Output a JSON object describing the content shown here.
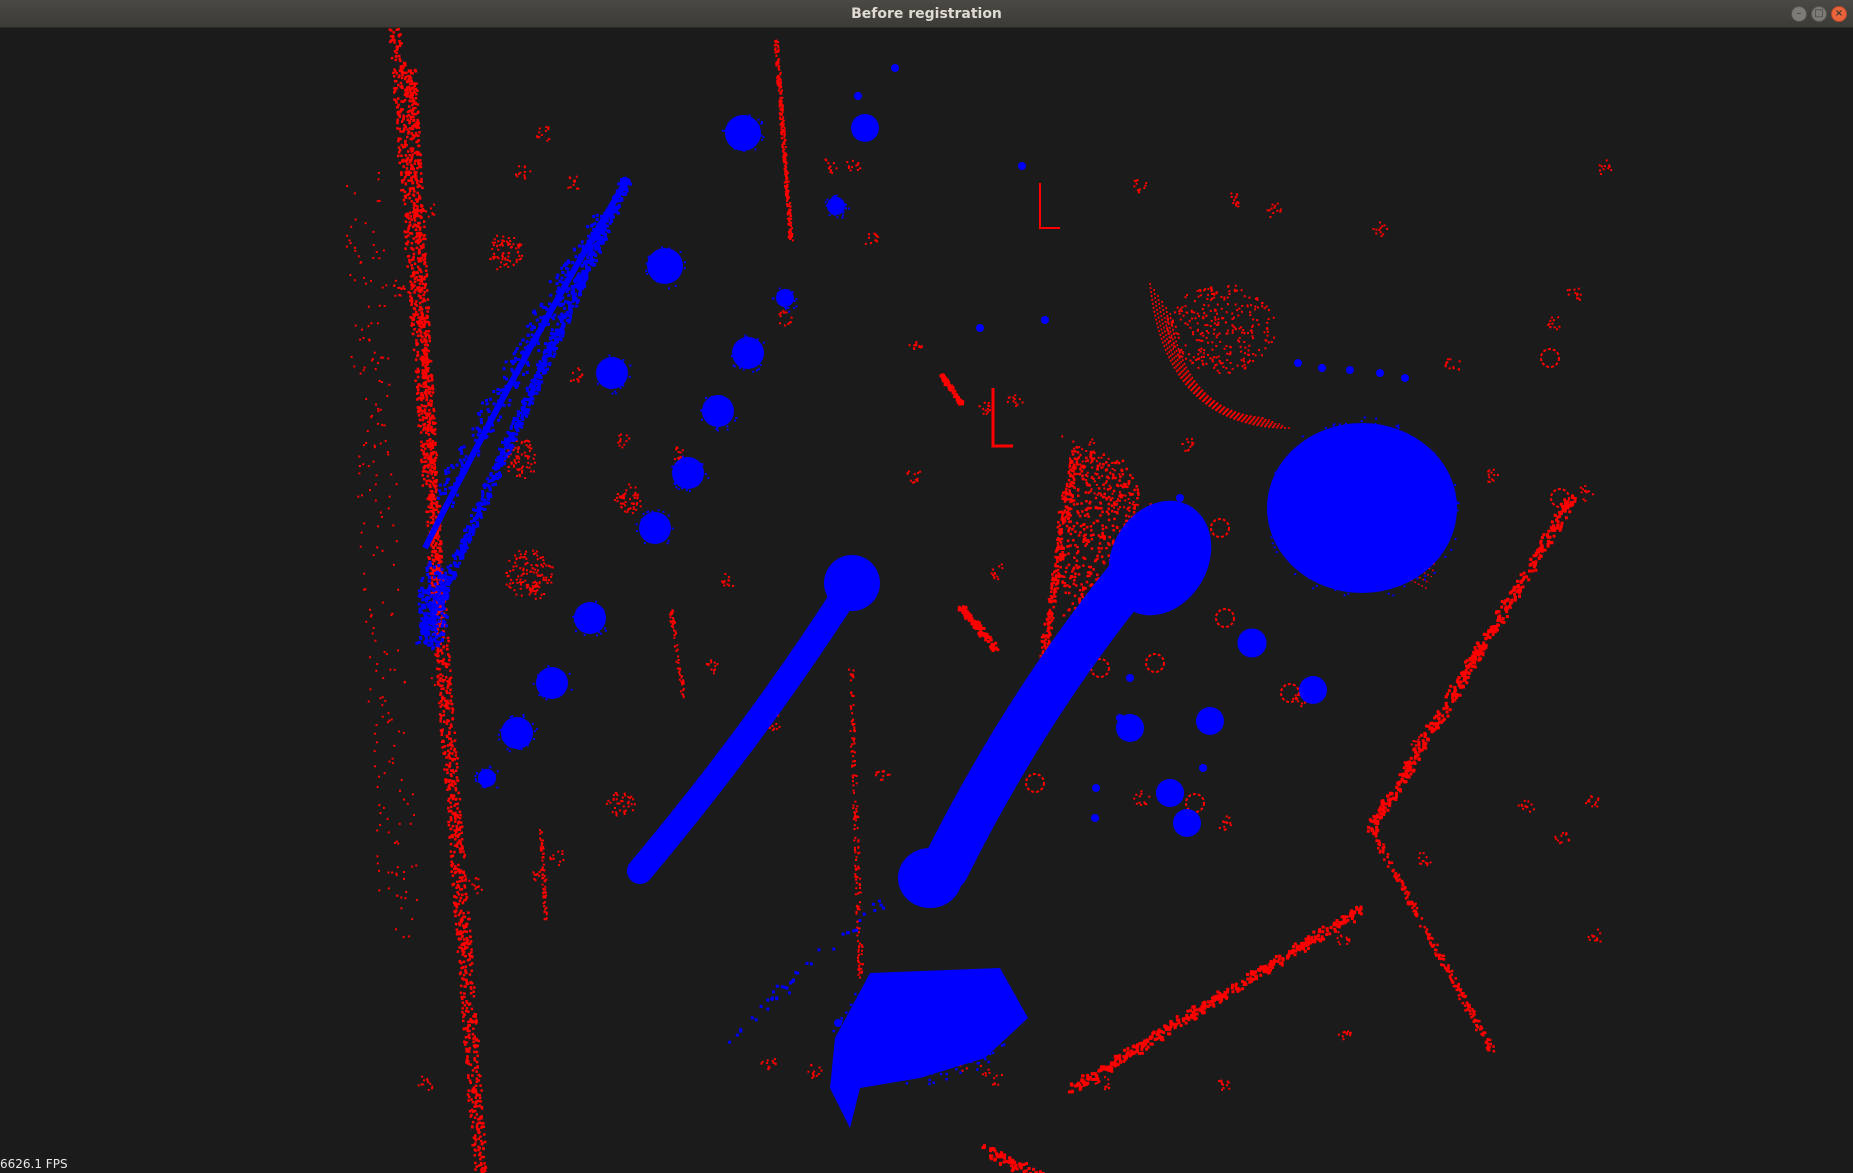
{
  "window": {
    "title": "Before registration",
    "controls": {
      "minimize_glyph": "–",
      "maximize_glyph": "□",
      "close_glyph": "×"
    }
  },
  "viewer": {
    "fps_text": "6626.1 FPS",
    "background_color": "#1b1b1b",
    "clouds": [
      {
        "role": "target",
        "color": "#ff0000"
      },
      {
        "role": "source",
        "color": "#0000ff"
      }
    ]
  }
}
